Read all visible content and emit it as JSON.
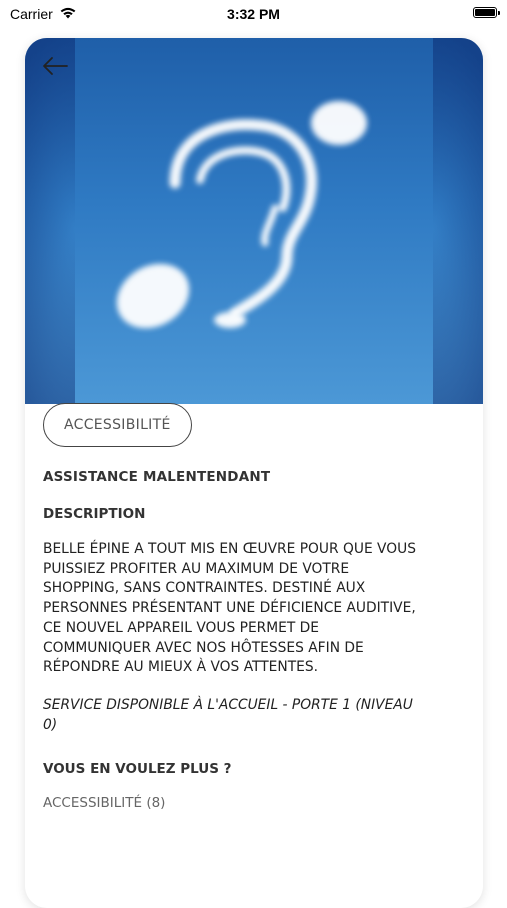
{
  "status_bar": {
    "carrier": "Carrier",
    "time": "3:32 PM"
  },
  "hero": {
    "image": "ear-shaped-clouds-in-blue-sky"
  },
  "detail": {
    "category_tag": "ACCESSIBILITÉ",
    "title": "ASSISTANCE MALENTENDANT",
    "description_label": "DESCRIPTION",
    "description_text": "BELLE ÉPINE A TOUT MIS EN ŒUVRE POUR QUE VOUS PUISSIEZ PROFITER AU MAXIMUM DE VOTRE SHOPPING, SANS CONTRAINTES. DESTINÉ AUX PERSONNES PRÉSENTANT UNE DÉFICIENCE AUDITIVE, CE NOUVEL APPAREIL VOUS PERMET DE COMMUNIQUER AVEC NOS HÔTESSES AFIN DE RÉPONDRE AU MIEUX À VOS ATTENTES.",
    "service_note": "SERVICE DISPONIBLE À L'ACCUEIL - PORTE 1 (NIVEAU 0)",
    "more_label": "VOUS EN VOULEZ PLUS ?",
    "more_link": "ACCESSIBILITÉ (8)"
  },
  "icons": {
    "wifi": "wifi-icon",
    "battery": "battery-icon",
    "back": "arrow-left-icon"
  }
}
